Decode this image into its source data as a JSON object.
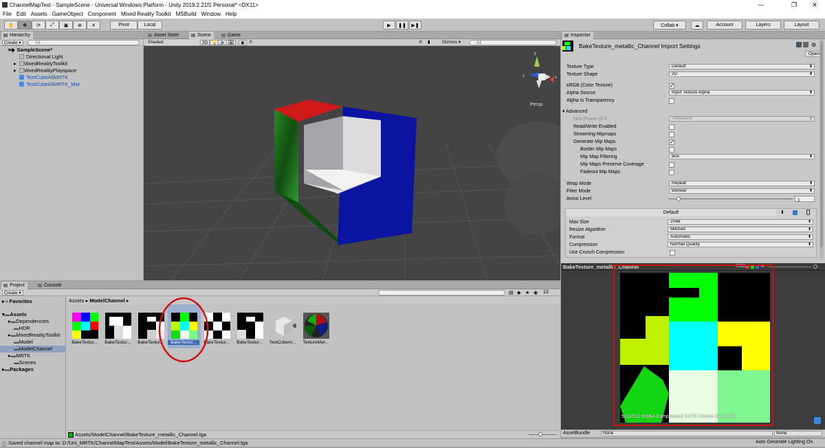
{
  "window": {
    "title": "ChannelMapTest - SampleScene - Universal Windows Platform - Unity 2019.2.21f1 Personal* <DX11>",
    "minimize": "—",
    "maximize": "❐",
    "close": "✕"
  },
  "menu": [
    "File",
    "Edit",
    "Assets",
    "GameObject",
    "Component",
    "Mixed Reality Toolkit",
    "MSBuild",
    "Window",
    "Help"
  ],
  "toolbar": {
    "pivot": "Pivot",
    "local": "Local",
    "collab": "Collab ▾",
    "account": "Account",
    "layers": "Layers",
    "layout": "Layout"
  },
  "hierarchy": {
    "tab": "Hierarchy",
    "create": "Create ▾",
    "search_placeholder": "All",
    "scene": "SampleScene*",
    "items": [
      "Directional Light",
      "MixedRealityToolkit",
      "MixedRealityPlayspace",
      "TestCubeAllMRTK",
      "TestCubeAllMRTK_Mat"
    ]
  },
  "center_tabs": {
    "asset_store": "Asset Store",
    "scene": "Scene",
    "game": "Game"
  },
  "scene_toolbar": {
    "shading": "Shaded",
    "mode_2d": "2D",
    "gizmos": "Gizmos ▾",
    "search_placeholder": "All",
    "fx_count": "0"
  },
  "scene_view": {
    "persp": "Persp",
    "axis_x": "x",
    "axis_y": "y",
    "axis_z": "z"
  },
  "inspector": {
    "tab": "Inspector",
    "title": "BakeTexture_metallic_Channel Import Settings",
    "open": "Open",
    "rows": [
      {
        "label": "Texture Type",
        "value": "Default"
      },
      {
        "label": "Texture Shape",
        "value": "2D"
      }
    ],
    "srgb": "sRGB (Color Texture)",
    "alpha_source": {
      "label": "Alpha Source",
      "value": "Input Texture Alpha"
    },
    "alpha_transparency": "Alpha Is Transparency",
    "advanced": "Advanced",
    "adv_rows": [
      {
        "label": "Non-Power of 2",
        "value": "ToNearest"
      },
      {
        "label": "Read/Write Enabled"
      },
      {
        "label": "Streaming Mipmaps"
      },
      {
        "label": "Generate Mip Maps"
      },
      {
        "label": "Border Mip Maps"
      },
      {
        "label": "Mip Map Filtering",
        "value": "Box"
      },
      {
        "label": "Mip Maps Preserve Coverage"
      },
      {
        "label": "Fadeout Mip Maps"
      }
    ],
    "wrap": {
      "label": "Wrap Mode",
      "value": "Repeat"
    },
    "filter": {
      "label": "Filter Mode",
      "value": "Bilinear"
    },
    "aniso": {
      "label": "Aniso Level",
      "value": "1",
      "level": 0.06
    },
    "platform": "Default",
    "plat_rows": [
      {
        "label": "Max Size",
        "value": "2048"
      },
      {
        "label": "Resize Algorithm",
        "value": "Mitchell"
      },
      {
        "label": "Format",
        "value": "Automatic"
      },
      {
        "label": "Compression",
        "value": "Normal Quality"
      }
    ],
    "crunch": "Use Crunch Compression"
  },
  "preview": {
    "title": "BakeTexture_metallic_Channel",
    "rgb": "RGB",
    "a": "A",
    "info": "512x512  RGBA Compressed DXT5 UNorm   341.4 KB"
  },
  "assetbundle": {
    "label": "AssetBundle",
    "value": "None",
    "variant": "None"
  },
  "project": {
    "tab": "Project",
    "console_tab": "Console",
    "create": "Create ▾",
    "favorites": "Favorites",
    "assets": "Assets",
    "folders": [
      "Dependencies",
      "HDR",
      "MixedRealityToolkit",
      "Model",
      "ModelChannel",
      "MRTK",
      "Scenes"
    ],
    "packages": "Packages",
    "breadcrumb_root": "Assets",
    "breadcrumb_leaf": "ModelChannel",
    "count": "13",
    "files": [
      "BakeTextur...",
      "BakeTextur...",
      "BakeTextur...",
      "BakeTextur...",
      "BakeTextur...",
      "BakeTextur...",
      "TestCubeAl...",
      "TextureMat..."
    ],
    "selected_path": "Assets/ModelChannel/BakeTexture_metallic_Channel.tga"
  },
  "status": {
    "message": "Saved channel map to: D:/Uni_MRTK/ChannelMapTest/Assets/Model/BakeTexture_metallic_Channel.tga",
    "right": "Auto Generate Lighting On"
  }
}
